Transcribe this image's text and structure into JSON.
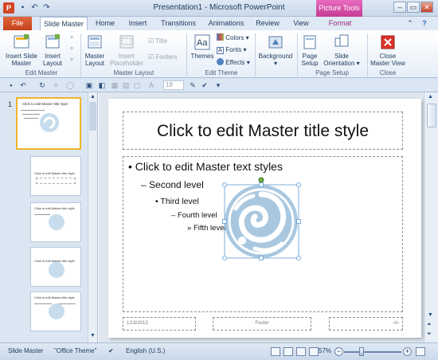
{
  "window": {
    "title": "Presentation1 - Microsoft PowerPoint",
    "context_tab_group": "Picture Tools",
    "app_icon_letter": "P"
  },
  "tabs": [
    "File",
    "Slide Master",
    "Home",
    "Insert",
    "Transitions",
    "Animations",
    "Review",
    "View",
    "Format"
  ],
  "ribbon": {
    "edit_master": {
      "label": "Edit Master",
      "insert_slide_master": "Insert Slide Master",
      "insert_layout": "Insert Layout"
    },
    "master_layout": {
      "label": "Master Layout",
      "master_layout_btn": "Master Layout",
      "insert_placeholder": "Insert Placeholder",
      "title_check": "Title",
      "footers_check": "Footers"
    },
    "edit_theme": {
      "label": "Edit Theme",
      "themes": "Themes",
      "colors": "Colors",
      "fonts": "Fonts",
      "effects": "Effects"
    },
    "background": {
      "label": "Background"
    },
    "page_setup": {
      "label": "Page Setup",
      "page_setup_btn": "Page Setup",
      "slide_orientation": "Slide Orientation"
    },
    "close": {
      "label": "Close",
      "close_master_view": "Close Master View"
    }
  },
  "qat": {
    "font_size": "18"
  },
  "thumbnails": {
    "master_number": "1",
    "master_title": "Click to edit Master title style",
    "layout_title": "Click to edit Master title style"
  },
  "slide": {
    "title": "Click to edit Master title style",
    "level1": "Click to edit Master text styles",
    "level2": "Second level",
    "level3": "Third level",
    "level4": "Fourth level",
    "level5": "Fifth level",
    "date": "1/19/2013",
    "footer": "Footer",
    "slide_number": "‹#›"
  },
  "status": {
    "view": "Slide Master",
    "theme": "\"Office Theme\"",
    "language": "English (U.S.)",
    "zoom": "57%"
  },
  "colors": {
    "file_tab": "#d24726",
    "picture_tools": "#c63a94",
    "selection_handle": "#5b9bd5",
    "rotation_handle": "#70ad47",
    "image_blue": "#a9c8e0"
  }
}
